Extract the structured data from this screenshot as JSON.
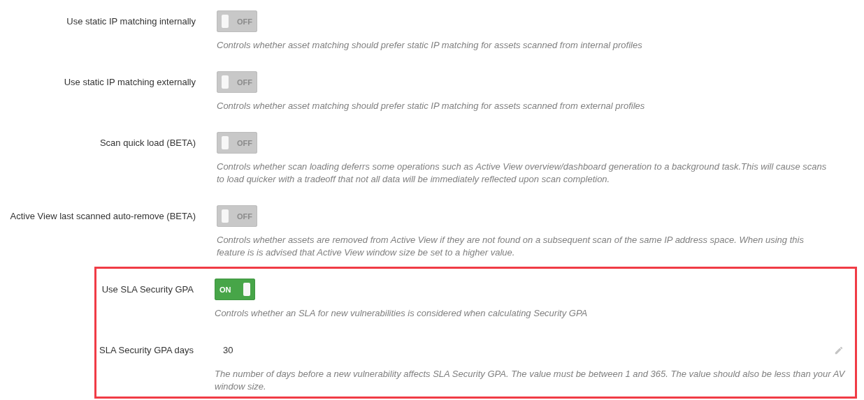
{
  "groups": [
    {
      "highlighted": false,
      "settings": [
        {
          "kind": "toggle",
          "label": "Use static IP matching internally",
          "on": false,
          "state_text": "OFF",
          "description": "Controls whether asset matching should prefer static IP matching for assets scanned from internal profiles"
        },
        {
          "kind": "toggle",
          "label": "Use static IP matching externally",
          "on": false,
          "state_text": "OFF",
          "description": "Controls whether asset matching should prefer static IP matching for assets scanned from external profiles"
        },
        {
          "kind": "toggle",
          "label": "Scan quick load (BETA)",
          "on": false,
          "state_text": "OFF",
          "description": "Controls whether scan loading deferrs some operations such as Active View overview/dashboard generation to a background task.This will cause scans to load quicker with a tradeoff that not all data will be immediately reflected upon scan completion."
        },
        {
          "kind": "toggle",
          "label": "Active View last scanned auto-remove (BETA)",
          "on": false,
          "state_text": "OFF",
          "description": "Controls whether assets are removed from Active View if they are not found on a subsequent scan of the same IP address space. When using this feature is is advised that Active View window size be set to a higher value."
        }
      ]
    },
    {
      "highlighted": true,
      "settings": [
        {
          "kind": "toggle",
          "label": "Use SLA Security GPA",
          "on": true,
          "state_text": "ON",
          "description": "Controls whether an SLA for new vulnerabilities is considered when calculating Security GPA"
        },
        {
          "kind": "number",
          "label": "SLA Security GPA days",
          "value": "30",
          "description": "The number of days before a new vulnerability affects SLA Security GPA. The value must be between 1 and 365. The value should also be less than your AV window size."
        }
      ]
    }
  ]
}
